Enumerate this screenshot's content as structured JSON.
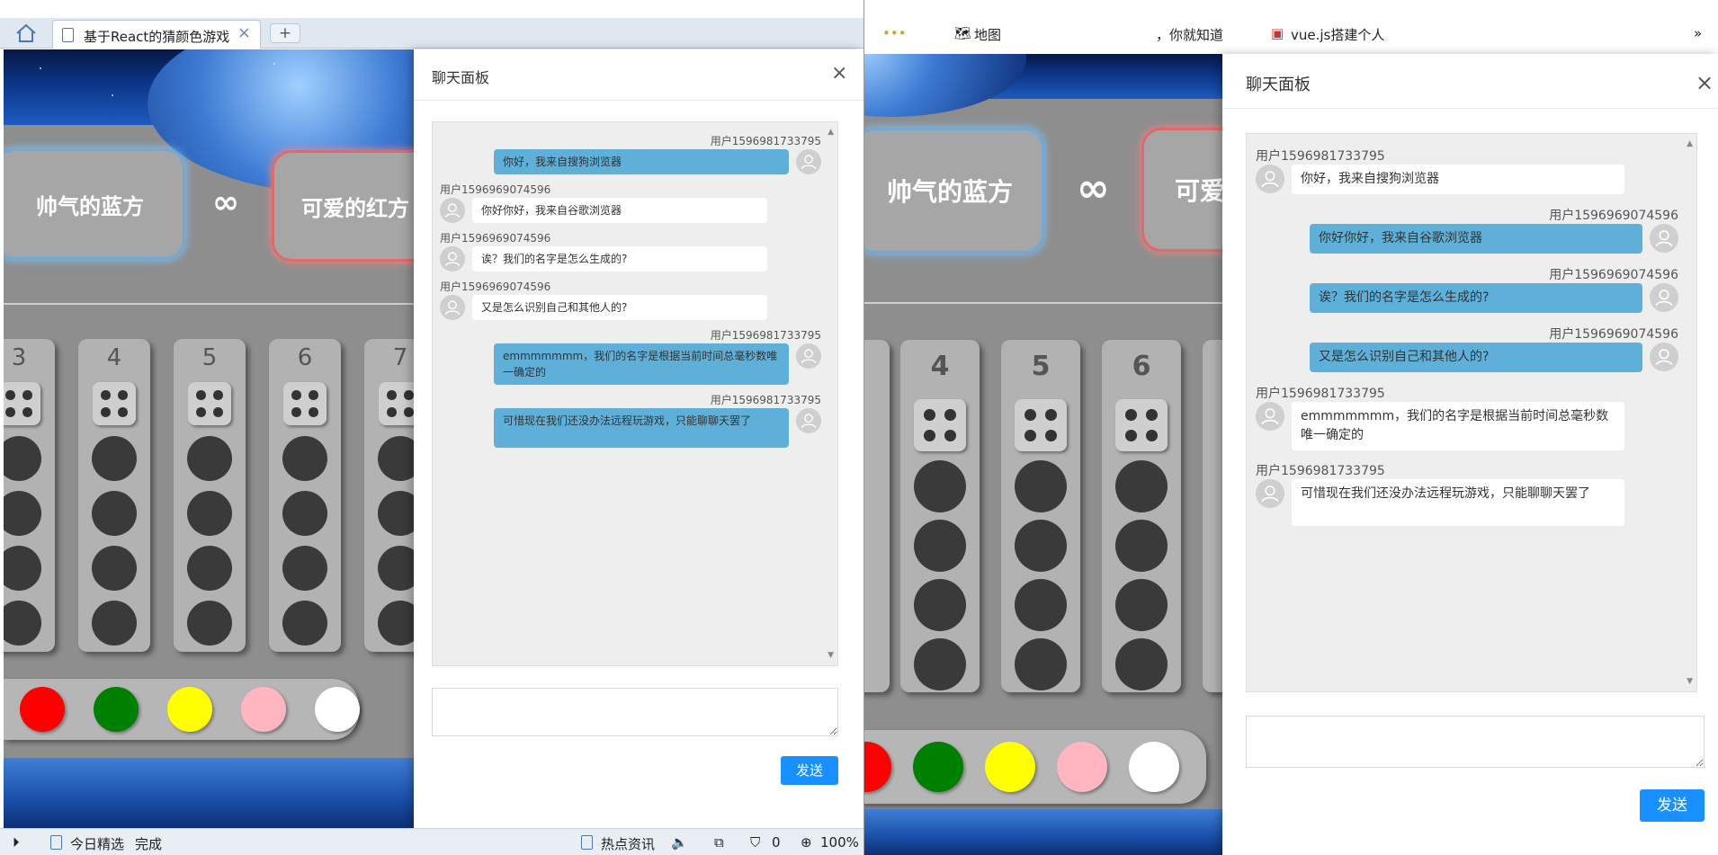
{
  "left_browser": {
    "tab_title": "基于React的猜颜色游戏",
    "tab_close": "×",
    "new_tab": "+",
    "status": {
      "daily_picks": "今日精选",
      "done": "完成",
      "hot_news": "热点资讯",
      "shield_count": "0",
      "zoom": "100%"
    }
  },
  "right_browser": {
    "bookmarks": {
      "map": "地图",
      "partial_1": "，你就知道",
      "partial_2": "vue.js搭建个人",
      "more": "»"
    }
  },
  "game": {
    "team_blue": "帅气的蓝方",
    "team_red": "可爱的红方",
    "team_red_right_cut": "可爱",
    "infinity": "∞",
    "left_columns": [
      "3",
      "4",
      "5",
      "6",
      "7"
    ],
    "right_columns": [
      "4",
      "5",
      "6"
    ],
    "palette_colors": [
      "#ff0000",
      "#008000",
      "#ffff00",
      "#ffb6c1",
      "#ffffff"
    ]
  },
  "chat_left": {
    "title": "聊天面板",
    "close": "×",
    "send": "发送",
    "messages": [
      {
        "user": "用户1596981733795",
        "text": "你好，我来自搜狗浏览器",
        "self": true
      },
      {
        "user": "用户1596969074596",
        "text": "你好你好，我来自谷歌浏览器",
        "self": false
      },
      {
        "user": "用户1596969074596",
        "text": "诶？我们的名字是怎么生成的?",
        "self": false
      },
      {
        "user": "用户1596969074596",
        "text": "又是怎么识别自己和其他人的?",
        "self": false
      },
      {
        "user": "用户1596981733795",
        "text": "emmmmmmm，我们的名字是根据当前时间总毫秒数唯一确定的",
        "self": true
      },
      {
        "user": "用户1596981733795",
        "text": "可惜现在我们还没办法远程玩游戏，只能聊聊天罢了",
        "self": true
      }
    ]
  },
  "chat_right": {
    "title": "聊天面板",
    "close": "×",
    "send": "发送",
    "messages": [
      {
        "user": "用户1596981733795",
        "text": "你好，我来自搜狗浏览器",
        "self": false
      },
      {
        "user": "用户1596969074596",
        "text": "你好你好，我来自谷歌浏览器",
        "self": true
      },
      {
        "user": "用户1596969074596",
        "text": "诶？我们的名字是怎么生成的?",
        "self": true
      },
      {
        "user": "用户1596969074596",
        "text": "又是怎么识别自己和其他人的?",
        "self": true
      },
      {
        "user": "用户1596981733795",
        "text": "emmmmmmm，我们的名字是根据当前时间总毫秒数唯一确定的",
        "self": false
      },
      {
        "user": "用户1596981733795",
        "text": "可惜现在我们还没办法远程玩游戏，只能聊聊天罢了",
        "self": false
      }
    ]
  }
}
